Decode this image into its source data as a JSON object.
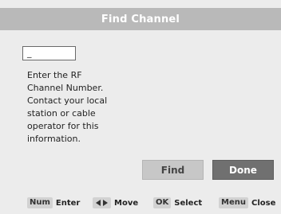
{
  "dialog": {
    "title": "Find Channel"
  },
  "channel_input": {
    "value": "_"
  },
  "instructions": [
    "Enter the RF",
    "Channel Number.",
    "Contact your local",
    "station or cable",
    "operator for this",
    "information."
  ],
  "buttons": {
    "find_label": "Find",
    "done_label": "Done"
  },
  "footer": {
    "num_key": "Num",
    "num_label": "Enter",
    "move_icon": "left-right-arrows-icon",
    "move_label": "Move",
    "ok_key": "OK",
    "ok_label": "Select",
    "menu_key": "Menu",
    "menu_label": "Close"
  },
  "colors": {
    "title_bar": "#b9b9b9",
    "dialog_bg": "#ececec",
    "find_button": "#c7c7c7",
    "done_button": "#707070",
    "key_badge": "#d2d2d2"
  }
}
